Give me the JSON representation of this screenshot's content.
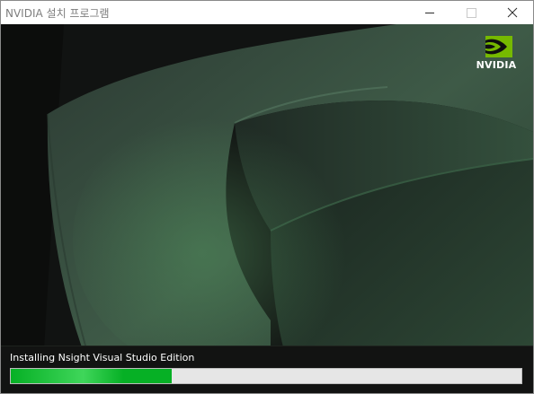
{
  "window": {
    "title": "NVIDIA 설치 프로그램"
  },
  "logo": {
    "brand_text": "NVIDIA",
    "icon": "nvidia-eye-icon",
    "color": "#76b900"
  },
  "install": {
    "status_text": "Installing Nsight Visual Studio Edition",
    "progress_fraction": 0.315,
    "progress_color": "#06b025"
  }
}
